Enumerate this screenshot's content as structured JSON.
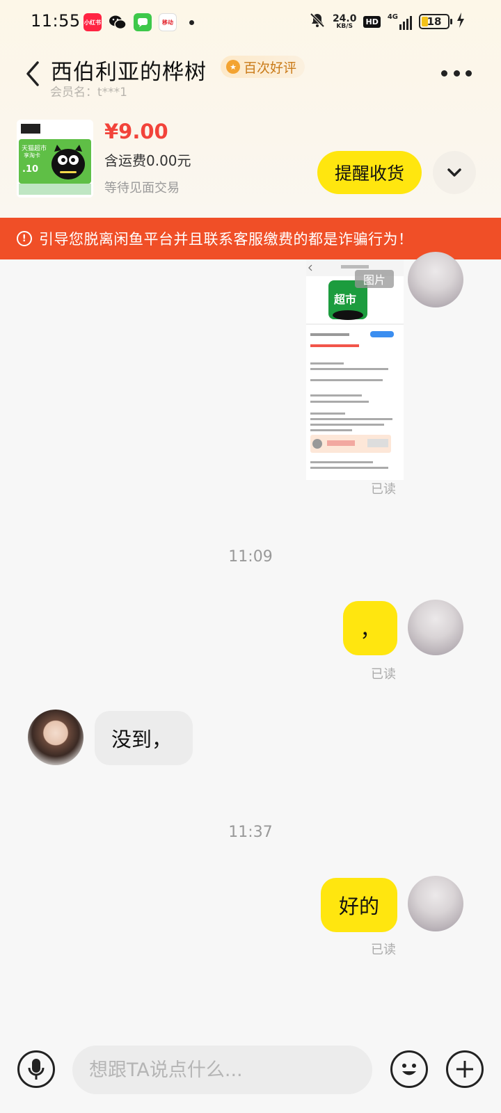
{
  "status_bar": {
    "time": "11:55",
    "apps": [
      "小红书",
      "wechat",
      "messages",
      "移动"
    ],
    "net_speed_value": "24.0",
    "net_speed_unit": "KB/S",
    "hd": "HD",
    "network": "4G",
    "battery": "18"
  },
  "header": {
    "title": "西伯利亚的桦树",
    "badge": "百次好评",
    "member": "会员名：t***1"
  },
  "product": {
    "thumb_text_top": "天猫超市",
    "thumb_text_sub": "享淘卡",
    "thumb_value": ".10",
    "price": "¥9.00",
    "shipping": "含运费0.00元",
    "status": "等待见面交易",
    "remind_button": "提醒收货"
  },
  "warning": {
    "text": "引导您脱离闲鱼平台并且联系客服缴费的都是诈骗行为！"
  },
  "messages": {
    "image_tag": "图片",
    "image_app_label": "超市",
    "read_label": "已读",
    "time_1": "11:09",
    "my_msg_1": "，",
    "their_msg_1": "没到，",
    "time_2": "11:37",
    "my_msg_2": "好的"
  },
  "input": {
    "placeholder": "想跟TA说点什么..."
  },
  "colors": {
    "accent_yellow": "#ffe60f",
    "price_red": "#f2433a",
    "warning_red": "#f04f27",
    "badge_gold": "#c97a18"
  },
  "icons": [
    "back-arrow-icon",
    "more-icon",
    "chevron-down-icon",
    "warning-icon",
    "microphone-icon",
    "emoji-icon",
    "plus-icon"
  ]
}
